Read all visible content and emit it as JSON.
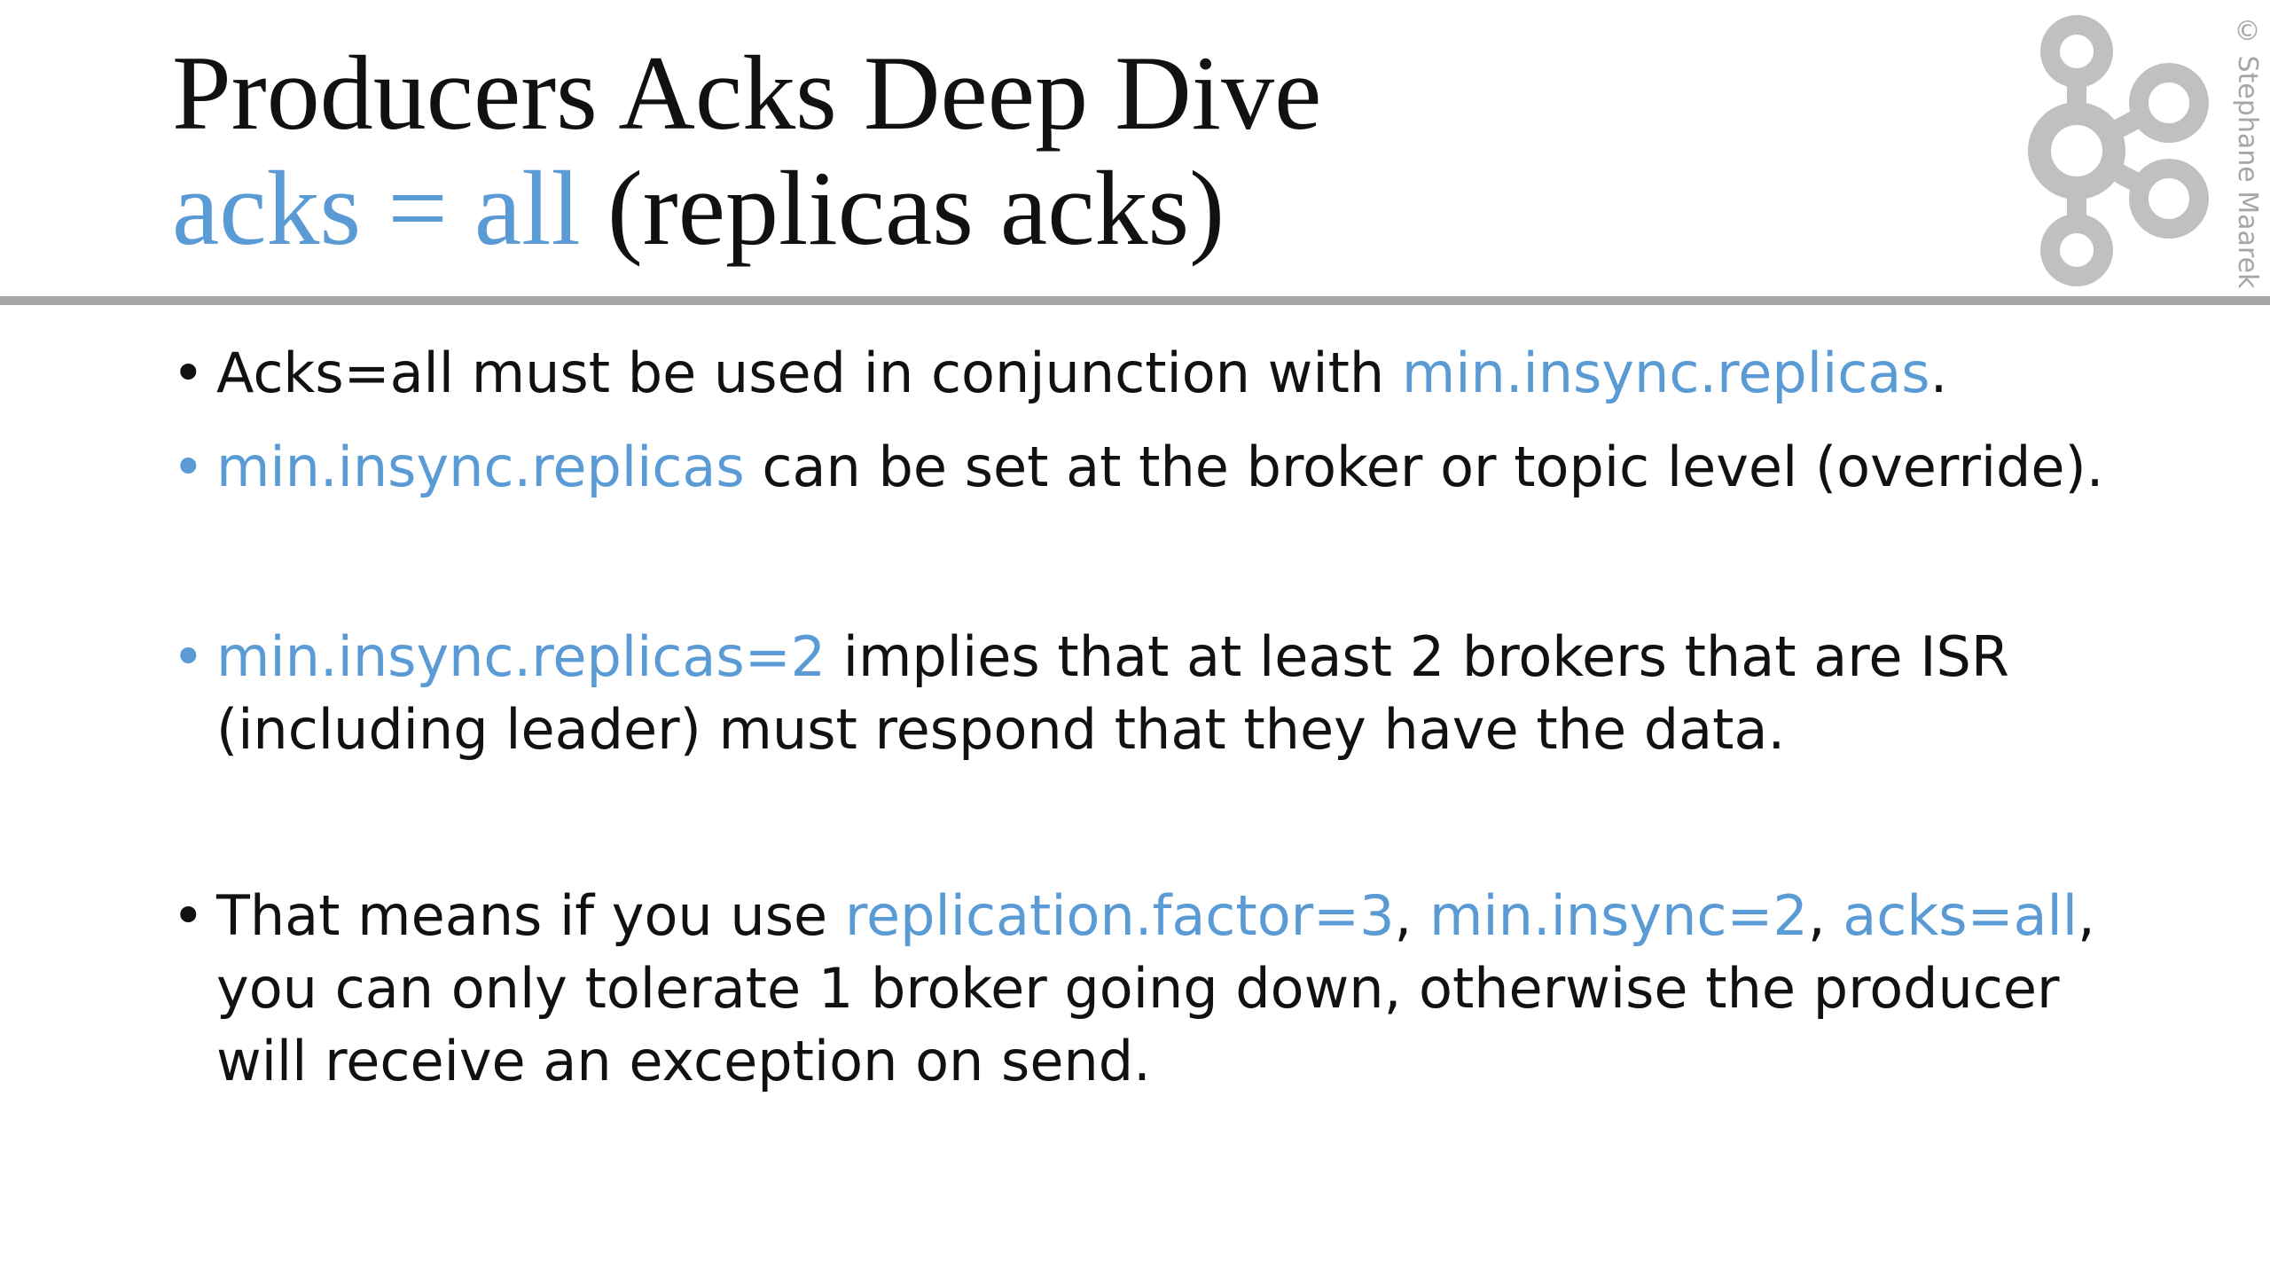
{
  "title": {
    "line1": "Producers Acks Deep Dive",
    "line2_accent": "acks = all",
    "line2_rest": " (replicas acks)"
  },
  "watermark": "© Stephane Maarek",
  "logo_icon": "kafka-logo-icon",
  "colors": {
    "accent": "#5b9bd5",
    "text": "#111111",
    "rule": "#a6a6a6"
  },
  "bullets": [
    {
      "dot": "•",
      "parts": [
        "Acks=all must be used in conjunction with ",
        "min.insync.replicas",
        "."
      ]
    },
    {
      "dot": "•",
      "parts": [
        "min.insync.replicas",
        " can be set at the broker or topic level (override)."
      ]
    },
    {
      "dot": "•",
      "parts": [
        "min.insync.replicas=2",
        " implies that at least 2 brokers that are ISR (including leader) must respond that they have the data."
      ]
    },
    {
      "dot": "•",
      "parts": [
        "That means if you use ",
        "replication.factor=3",
        ", ",
        "min.insync=2",
        ", ",
        "acks=all",
        ", you can only tolerate 1 broker going down, otherwise the producer will receive an exception on send."
      ]
    }
  ]
}
